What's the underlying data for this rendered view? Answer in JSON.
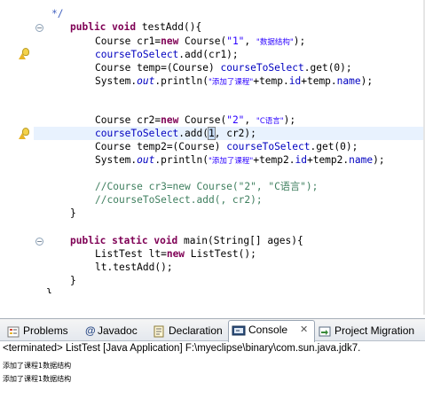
{
  "editor": {
    "lines": {
      "l0": "*/",
      "l1_kw1": "public",
      "l1_kw2": "void",
      "l1_rest": " testAdd(){",
      "l2_a": "Course cr1=",
      "l2_new": "new",
      "l2_b": " Course(",
      "l2_s1": "\"1\"",
      "l2_c": ", ",
      "l2_s2": "\"数据结构\"",
      "l2_d": ");",
      "l3_f": "courseToSelect",
      "l3_r": ".add(cr1);",
      "l4_a": "Course temp=(Course) ",
      "l4_f": "courseToSelect",
      "l4_r": ".get(0);",
      "l5_a": "System.",
      "l5_out": "out",
      "l5_b": ".println(",
      "l5_s": "\"添加了课程\"",
      "l5_c": "+temp.",
      "l5_id": "id",
      "l5_d": "+temp.",
      "l5_name": "name",
      "l5_e": ");",
      "l6_a": "Course cr2=",
      "l6_new": "new",
      "l6_b": " Course(",
      "l6_s1": "\"2\"",
      "l6_c": ", ",
      "l6_s2": "\"C语言\"",
      "l6_d": ");",
      "l7_f": "courseToSelect",
      "l7_a": ".add(",
      "l7_cur": "1",
      "l7_b": ", cr2);",
      "l8_a": "Course temp2=(Course) ",
      "l8_f": "courseToSelect",
      "l8_r": ".get(0);",
      "l9_a": "System.",
      "l9_out": "out",
      "l9_b": ".println(",
      "l9_s": "\"添加了课程\"",
      "l9_c": "+temp2.",
      "l9_id": "id",
      "l9_d": "+temp2.",
      "l9_name": "name",
      "l9_e": ");",
      "l10": "//Course cr3=new Course(\"2\", \"C语言\");",
      "l11": "//courseToSelect.add(, cr2);",
      "l12": "}",
      "l13_kw1": "public",
      "l13_kw2": "static",
      "l13_kw3": "void",
      "l13_rest": " main(String[] ages){",
      "l14_a": "ListTest lt=",
      "l14_new": "new",
      "l14_b": " ListTest();",
      "l15": "lt.testAdd();",
      "l16": "}",
      "l17": "}"
    }
  },
  "panel": {
    "tabs": {
      "problems": "Problems",
      "javadoc": "Javadoc",
      "javadoc_at": "@",
      "declaration": "Declaration",
      "console": "Console",
      "console_close": "✕",
      "migration": "Project Migration"
    },
    "console": {
      "status": "<terminated> ListTest [Java Application] F:\\myeclipse\\binary\\com.sun.java.jdk7.",
      "out1": "添加了课程1数据结构",
      "out2": "添加了课程1数据结构"
    }
  },
  "colors": {
    "keyword": "#7f0055",
    "string": "#2a00ff",
    "field": "#0000c0",
    "comment": "#3f7f5f",
    "current_line": "#e8f2fe"
  }
}
